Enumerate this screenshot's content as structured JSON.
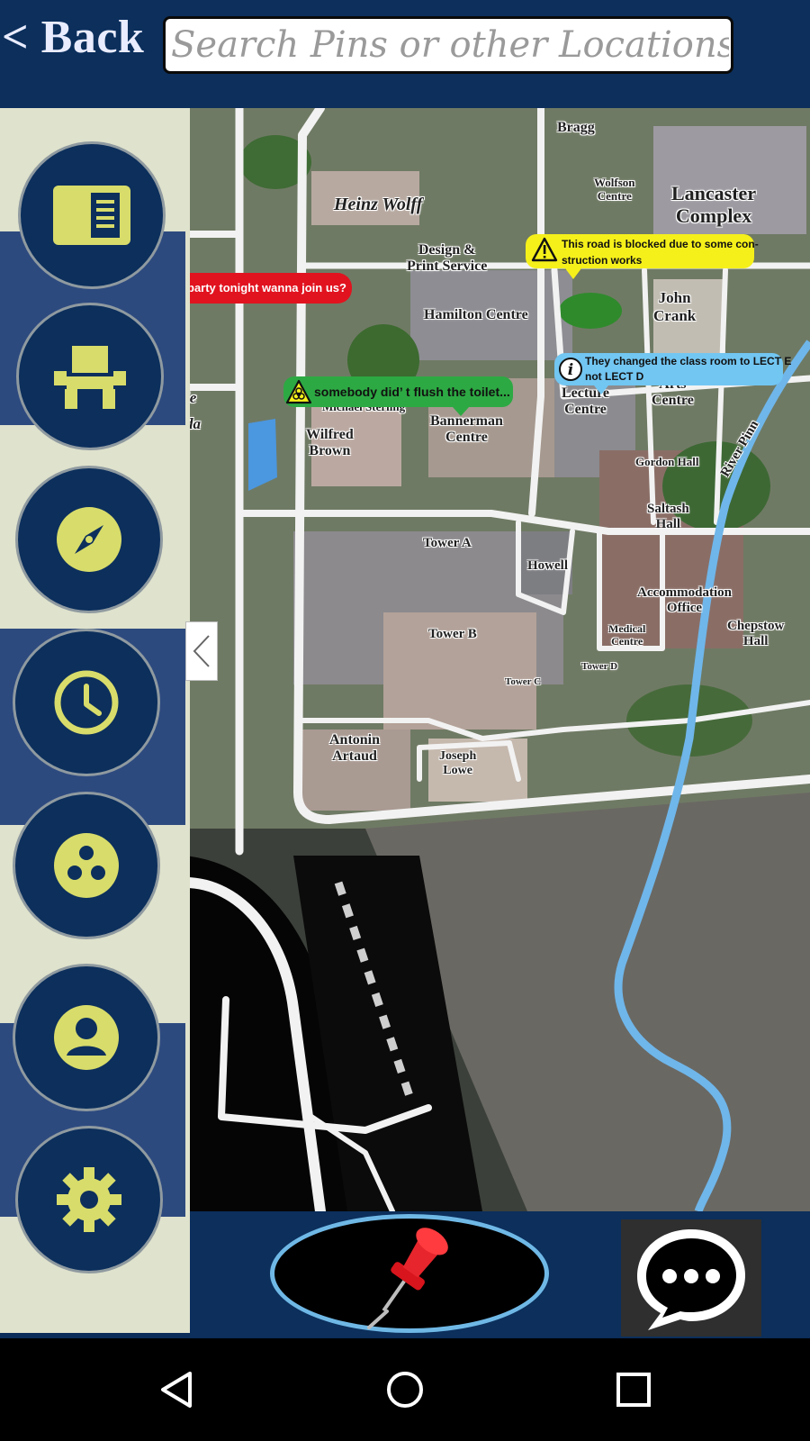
{
  "header": {
    "back_label": "< Back",
    "search_placeholder": "Search Pins or other Locations",
    "search_value": ""
  },
  "sidebar": {
    "items": [
      {
        "icon": "news-icon",
        "label": "News"
      },
      {
        "icon": "seat-icon",
        "label": "Seats"
      },
      {
        "icon": "compass-icon",
        "label": "Explore"
      },
      {
        "icon": "clock-icon",
        "label": "Timetable"
      },
      {
        "icon": "groups-icon",
        "label": "Groups"
      },
      {
        "icon": "profile-icon",
        "label": "Profile"
      },
      {
        "icon": "gear-icon",
        "label": "Settings"
      }
    ],
    "collapse_symbol": "<"
  },
  "map": {
    "labels": [
      {
        "text": "Bragg"
      },
      {
        "text": "Heinz Wolff"
      },
      {
        "text": "Wolfson\nCentre"
      },
      {
        "text": "Lancaster\nComplex"
      },
      {
        "text": "Design &\nPrint Service"
      },
      {
        "text": "Hamilton Centre"
      },
      {
        "text": "John\nCrank"
      },
      {
        "text": "Lecture\nCentre"
      },
      {
        "text": "Arts\nCentre"
      },
      {
        "text": "Michael Sterling"
      },
      {
        "text": "Wilfred\nBrown"
      },
      {
        "text": "Bannerman\nCentre"
      },
      {
        "text": "Gordon Hall"
      },
      {
        "text": "River Pinn"
      },
      {
        "text": "Saltash\nHall"
      },
      {
        "text": "Tower A"
      },
      {
        "text": "Howell"
      },
      {
        "text": "Accommodation\nOffice"
      },
      {
        "text": "Tower B"
      },
      {
        "text": "Medical\nCentre"
      },
      {
        "text": "Chepstow\nHall"
      },
      {
        "text": "Tower D"
      },
      {
        "text": "Tower C"
      },
      {
        "text": "Antonin\nArtaud"
      },
      {
        "text": "Joseph\nLowe"
      },
      {
        "text": "ie"
      },
      {
        "text": "da"
      }
    ],
    "pins": [
      {
        "type": "social",
        "color": "#e1131f",
        "text": "party tonight wanna join us?"
      },
      {
        "type": "warning",
        "color": "#f5f01a",
        "icon": "warning-icon",
        "text": "This road is blocked due to some con-\nstruction works"
      },
      {
        "type": "info",
        "color": "#72c6f2",
        "icon": "info-icon",
        "text": "They changed the class room to LECT E\nnot LECT D"
      },
      {
        "type": "hazard",
        "color": "#2da943",
        "icon": "biohazard-icon",
        "text": "somebody did’ t flush the toilet..."
      }
    ]
  },
  "actions": {
    "add_pin_icon": "pushpin-icon",
    "chat_icon": "chat-bubble-icon"
  },
  "android_nav": {
    "back_icon": "nav-back-icon",
    "home_icon": "nav-home-icon",
    "recents_icon": "nav-recents-icon"
  },
  "colors": {
    "primary": "#0c2f5c",
    "accent": "#d8dc6a",
    "sidebar_bg": "#dfe2cc",
    "sidebar_band": "#2d4a7f"
  }
}
